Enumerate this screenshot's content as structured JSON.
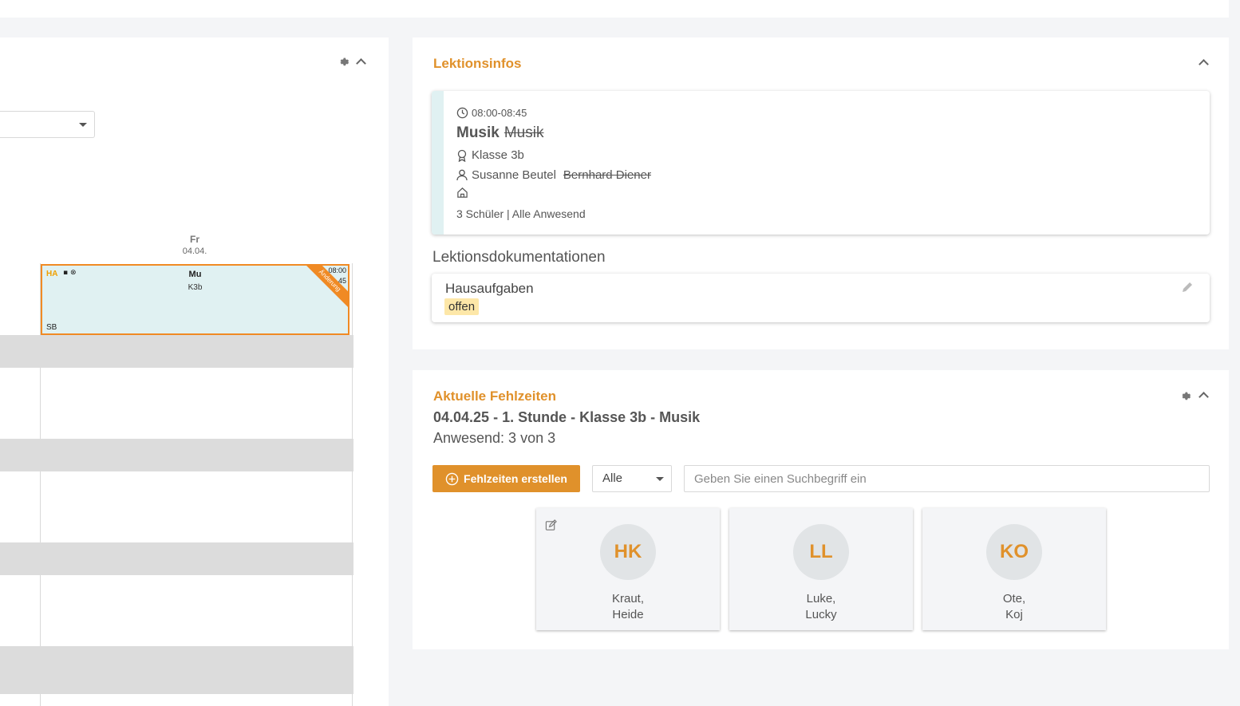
{
  "left": {
    "day_name": "Fr",
    "day_date": "04.04.",
    "lesson": {
      "ha": "HA",
      "icons": "▪ ⊗",
      "subject": "Mu",
      "class": "K3b",
      "teacher": "SB",
      "time_start": "08:00",
      "time_end": "45",
      "ribbon": "Änderung"
    }
  },
  "lektionsinfos": {
    "title": "Lektionsinfos",
    "time": "08:00-08:45",
    "subject": "Musik",
    "subject_old": "Musik",
    "class": "Klasse 3b",
    "teacher": "Susanne Beutel",
    "teacher_old": "Bernhard Diener",
    "room": "",
    "summary": "3 Schüler |  Alle Anwesend",
    "doc_title": "Lektionsdokumentationen",
    "doc_item": "Hausaufgaben",
    "doc_status": "offen"
  },
  "fehlzeiten": {
    "title": "Aktuelle Fehlzeiten",
    "subtitle": "04.04.25 - 1. Stunde - Klasse 3b - Musik",
    "present": "Anwesend: 3 von 3",
    "create_label": "Fehlzeiten erstellen",
    "filter_value": "Alle",
    "search_placeholder": "Geben Sie einen Suchbegriff ein",
    "students": [
      {
        "initials": "HK",
        "last": "Kraut,",
        "first": "Heide"
      },
      {
        "initials": "LL",
        "last": "Luke,",
        "first": "Lucky"
      },
      {
        "initials": "KO",
        "last": "Ote,",
        "first": "Koj"
      }
    ]
  },
  "colors": {
    "accent": "#e0912b",
    "lesson_bg": "#e0f1f2",
    "lesson_border": "#f08a24",
    "badge": "#fde7a8"
  }
}
